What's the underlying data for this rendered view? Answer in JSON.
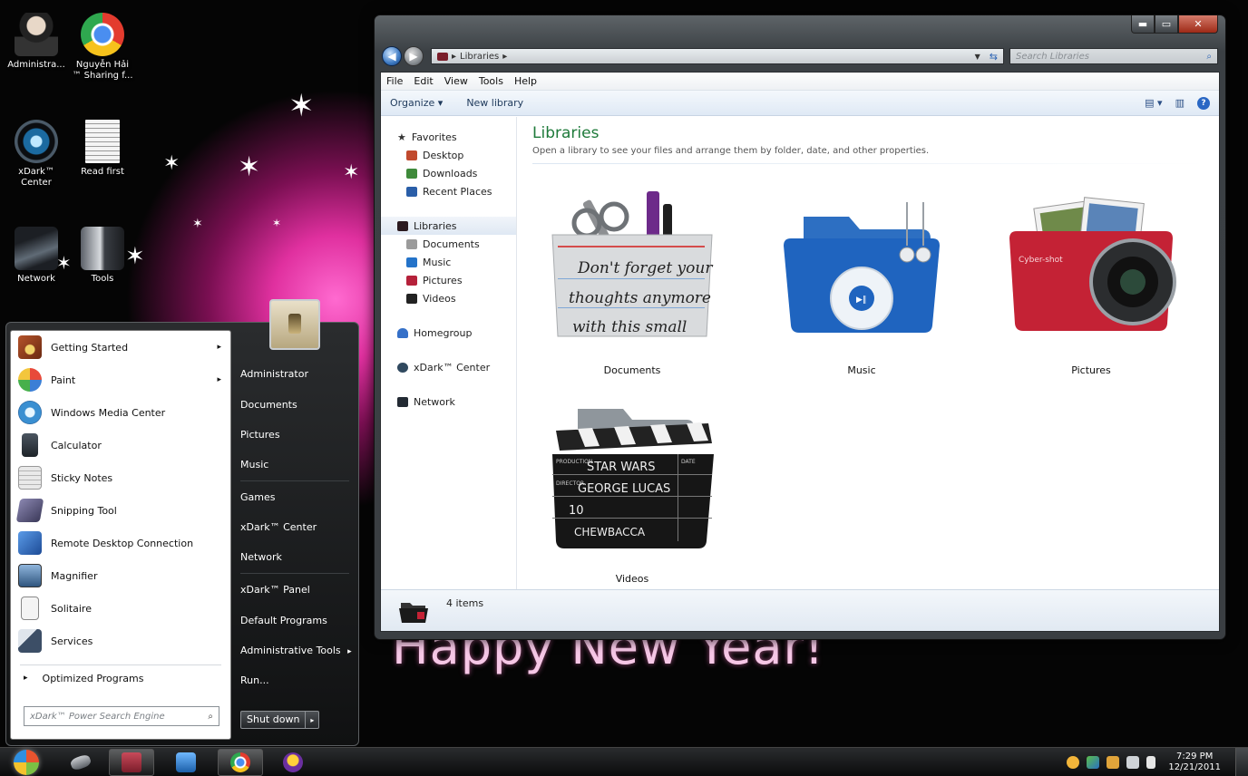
{
  "desktop": {
    "icons": [
      {
        "label": "Administra...",
        "icon": "user-figure-icon"
      },
      {
        "label": "Nguyễn Hải ™ Sharing f...",
        "icon": "chrome-icon"
      },
      {
        "label": "xDark™ Center",
        "icon": "xdark-center-icon"
      },
      {
        "label": "Read first",
        "icon": "text-document-icon"
      },
      {
        "label": "Network",
        "icon": "network-icon"
      },
      {
        "label": "Tools",
        "icon": "tools-folder-icon"
      }
    ],
    "greeting": "Happy New Year!"
  },
  "explorer": {
    "window_buttons": {
      "minimize": "▬",
      "maximize": "▭",
      "close": "✕"
    },
    "address": {
      "crumb": "Libraries",
      "separator": "▸"
    },
    "search_placeholder": "Search Libraries",
    "menu": [
      "File",
      "Edit",
      "View",
      "Tools",
      "Help"
    ],
    "toolbar": {
      "organize": "Organize ▾",
      "new_library": "New library"
    },
    "nav": {
      "favorites": {
        "label": "Favorites",
        "items": [
          "Desktop",
          "Downloads",
          "Recent Places"
        ]
      },
      "libraries": {
        "label": "Libraries",
        "items": [
          "Documents",
          "Music",
          "Pictures",
          "Videos"
        ]
      },
      "homegroup": "Homegroup",
      "xdark": "xDark™ Center",
      "network": "Network"
    },
    "heading": "Libraries",
    "subheading": "Open a library to see your files and arrange them by folder, date, and other properties.",
    "libraries": [
      {
        "name": "Documents",
        "note_lines": [
          "Don't forget your",
          "thoughts anymore",
          "with this small"
        ]
      },
      {
        "name": "Music",
        "brand": ""
      },
      {
        "name": "Pictures",
        "brand": "Cyber-shot"
      },
      {
        "name": "Videos",
        "slate_lines": [
          "STAR WARS",
          "GEORGE LUCAS",
          "10",
          "CHEWBACCA"
        ],
        "slate_tags": [
          "PRODUCTION",
          "DIRECTOR",
          "DATE"
        ]
      }
    ],
    "status": {
      "count": "4 items"
    }
  },
  "start_menu": {
    "programs": [
      {
        "label": "Getting Started",
        "submenu": true,
        "color": "#b4532a"
      },
      {
        "label": "Paint",
        "submenu": true,
        "color": "#d9a64c"
      },
      {
        "label": "Windows Media Center",
        "submenu": false,
        "color": "#3a8fd1"
      },
      {
        "label": "Calculator",
        "submenu": false,
        "color": "#333a44"
      },
      {
        "label": "Sticky Notes",
        "submenu": false,
        "color": "#c9c9c9"
      },
      {
        "label": "Snipping Tool",
        "submenu": false,
        "color": "#6d6a8a"
      },
      {
        "label": "Remote Desktop Connection",
        "submenu": false,
        "color": "#2a63b5"
      },
      {
        "label": "Magnifier",
        "submenu": false,
        "color": "#4b6f94"
      },
      {
        "label": "Solitaire",
        "submenu": false,
        "color": "#9aa6b2"
      },
      {
        "label": "Services",
        "submenu": false,
        "color": "#3c4e66"
      }
    ],
    "all_programs": "Optimized Programs",
    "search_placeholder": "xDark™ Power Search Engine",
    "right_links": [
      "Administrator",
      "Documents",
      "Pictures",
      "Music",
      "Games",
      "xDark™ Center",
      "Network",
      "xDark™ Panel",
      "Default Programs",
      "Administrative Tools",
      "Run..."
    ],
    "shutdown": "Shut down",
    "arrow": "▸",
    "submenu_arrow": "▸"
  },
  "taskbar": {
    "clock_time": "7:29 PM",
    "clock_date": "12/21/2011"
  }
}
